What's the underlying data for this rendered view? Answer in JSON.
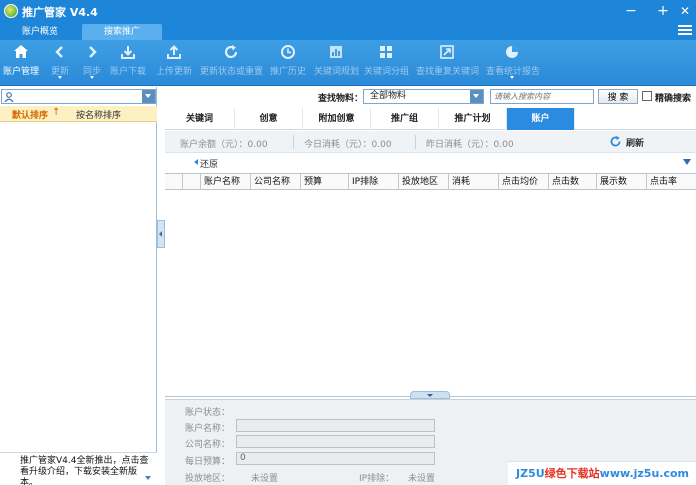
{
  "window": {
    "title": "推广管家 V4.4",
    "minimize": "−",
    "maximize": "+",
    "close": "✕"
  },
  "top_tabs": [
    {
      "label": "账户概览",
      "active": false
    },
    {
      "label": "搜索推广",
      "active": true
    }
  ],
  "toolbar": [
    {
      "label": "账户管理",
      "icon": "home-icon",
      "dim": false
    },
    {
      "label": "更新",
      "icon": "back-icon",
      "dim": true,
      "has_caret": true
    },
    {
      "label": "同步",
      "icon": "forward-icon",
      "dim": true,
      "has_caret": true
    },
    {
      "label": "账户下载",
      "icon": "download-icon",
      "dim": true
    },
    {
      "label": "上传更新",
      "icon": "upload-icon",
      "dim": true
    },
    {
      "label": "更新状态或重置",
      "icon": "refresh-icon",
      "dim": true
    },
    {
      "label": "推广历史",
      "icon": "clock-icon",
      "dim": true
    },
    {
      "label": "关键词规划",
      "icon": "chart-icon",
      "dim": true
    },
    {
      "label": "关键词分组",
      "icon": "grid-icon",
      "dim": true
    },
    {
      "label": "查找重复关键词",
      "icon": "expand-icon",
      "dim": true
    },
    {
      "label": "查看统计报告",
      "icon": "pie-icon",
      "dim": true,
      "has_caret": true
    }
  ],
  "left": {
    "search_placeholder": "",
    "sort_default": "默认排序",
    "sort_arrow": "↑",
    "sort_by_name": "按名称排序",
    "notice": "推广管家V4.4全新推出，点击查看升级介绍，下载安装全新版本。"
  },
  "filter": {
    "find_label": "查找物料：",
    "selected": "全部物料",
    "keyword_placeholder": "请输入搜索内容",
    "search_button": "搜 索",
    "exact_label": "精确搜索"
  },
  "tabs": [
    {
      "label": "关键词",
      "active": false
    },
    {
      "label": "创意",
      "active": false
    },
    {
      "label": "附加创意",
      "active": false
    },
    {
      "label": "推广组",
      "active": false
    },
    {
      "label": "推广计划",
      "active": false
    },
    {
      "label": "账户",
      "active": true
    }
  ],
  "stats": {
    "balance": "账户余额（元）：0.00",
    "today": "今日消耗（元）：0.00",
    "yesterday": "昨日消耗（元）：0.00",
    "refresh": "刷新"
  },
  "restore": "还原",
  "grid_columns": [
    "",
    "",
    "账户名称",
    "公司名称",
    "预算",
    "IP排除",
    "投放地区",
    "消耗",
    "点击均价",
    "点击数",
    "展示数",
    "点击率"
  ],
  "detail": {
    "status_label": "账户状态：",
    "name_label": "账户名称：",
    "company_label": "公司名称：",
    "budget_label": "每日预算：",
    "budget_value": "0",
    "region_label": "投放地区：",
    "region_value": "未设置",
    "ip_label": "IP排除：",
    "ip_value": "未设置"
  },
  "watermark": {
    "a": "JZ5U",
    "b": "绿色下载站",
    "c": "www.jz5u.com"
  }
}
